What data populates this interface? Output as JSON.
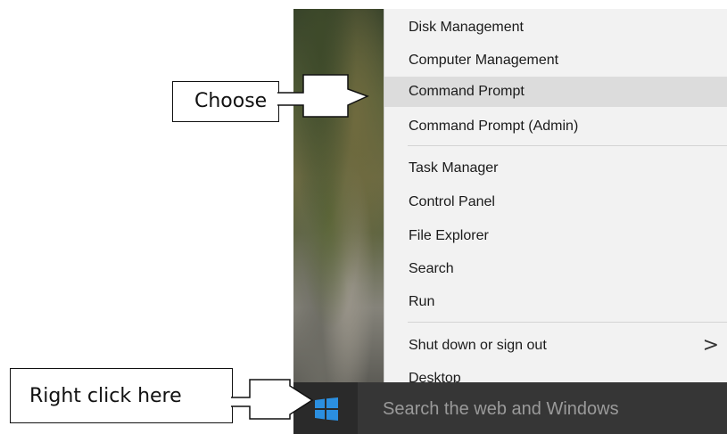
{
  "menu": {
    "items": [
      {
        "label": "Disk Management"
      },
      {
        "label": "Computer Management"
      },
      {
        "label": "Command Prompt"
      },
      {
        "label": "Command Prompt (Admin)"
      },
      {
        "label": "Task Manager"
      },
      {
        "label": "Control Panel"
      },
      {
        "label": "File Explorer"
      },
      {
        "label": "Search"
      },
      {
        "label": "Run"
      },
      {
        "label": "Shut down or sign out",
        "submenu_indicator": ">"
      },
      {
        "label": "Desktop"
      }
    ]
  },
  "taskbar": {
    "search_placeholder": "Search the web and Windows",
    "start_icon": "windows-logo-icon"
  },
  "annotations": {
    "choose_label": "Choose",
    "right_click_label": "Right click here"
  },
  "colors": {
    "menu_bg": "#f2f2f2",
    "highlight": "#dcdcdc",
    "taskbar_bg": "#1e1e1e",
    "search_bg": "#363636",
    "windows_blue": "#2b8fe0"
  }
}
